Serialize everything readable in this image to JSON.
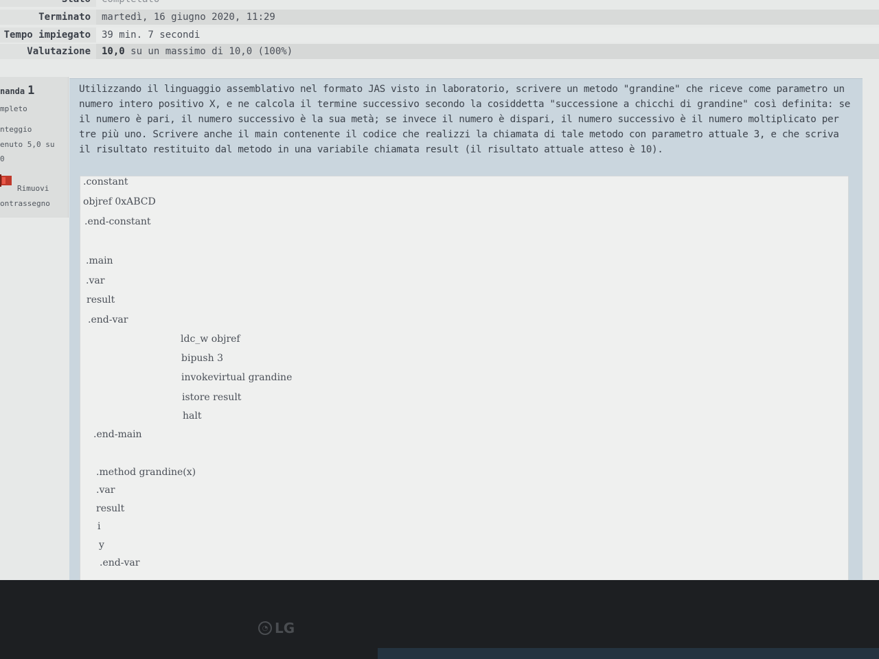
{
  "summary": {
    "stato_label": "Stato",
    "stato_value": "Completato",
    "terminato_label": "Terminato",
    "terminato_value": "martedì, 16 giugno 2020, 11:29",
    "tempo_label": "Tempo impiegato",
    "tempo_value": "39 min. 7 secondi",
    "valutazione_label": "Valutazione",
    "valutazione_score": "10,0",
    "valutazione_rest": " su un massimo di 10,0 (100%)"
  },
  "info": {
    "question_label": "nanda",
    "question_number": "1",
    "state": "mpleto",
    "mark_line1": "nteggio",
    "mark_line2": "enuto 5,0 su",
    "mark_line3": "0",
    "flag_line1": "Rimuovi",
    "flag_line2": "ontrassegno"
  },
  "question": {
    "text": "Utilizzando il linguaggio assemblativo nel formato JAS visto in laboratorio, scrivere un metodo \"grandine\" che riceve come parametro un numero intero positivo X, e ne calcola il termine successivo secondo la cosiddetta \"successione a chicchi di grandine\" così definita: se il numero è pari, il numero successivo è la sua metà; se invece il numero è dispari, il numero successivo è il numero moltiplicato per tre più uno. Scrivere anche il main contenente il codice che realizzi la chiamata di tale metodo con parametro attuale 3, e che scriva il risultato restituito dal metodo in una variabile chiamata result (il risultato attuale atteso è 10)."
  },
  "answer_lines": [
    ".constant",
    "objref 0xABCD",
    ".end-constant",
    ".main",
    ".var",
    "result",
    ".end-var",
    "ldc_w objref",
    "bipush 3",
    "invokevirtual grandine",
    "istore result",
    "halt",
    ".end-main",
    ".method grandine(x)",
    ".var",
    "result",
    "i",
    "y",
    ".end-var"
  ],
  "monitor": {
    "brand": "LG"
  },
  "colors": {
    "question_bg": "#cad6de",
    "answer_bg": "#eff0ef",
    "bezel": "#1d1f22"
  }
}
